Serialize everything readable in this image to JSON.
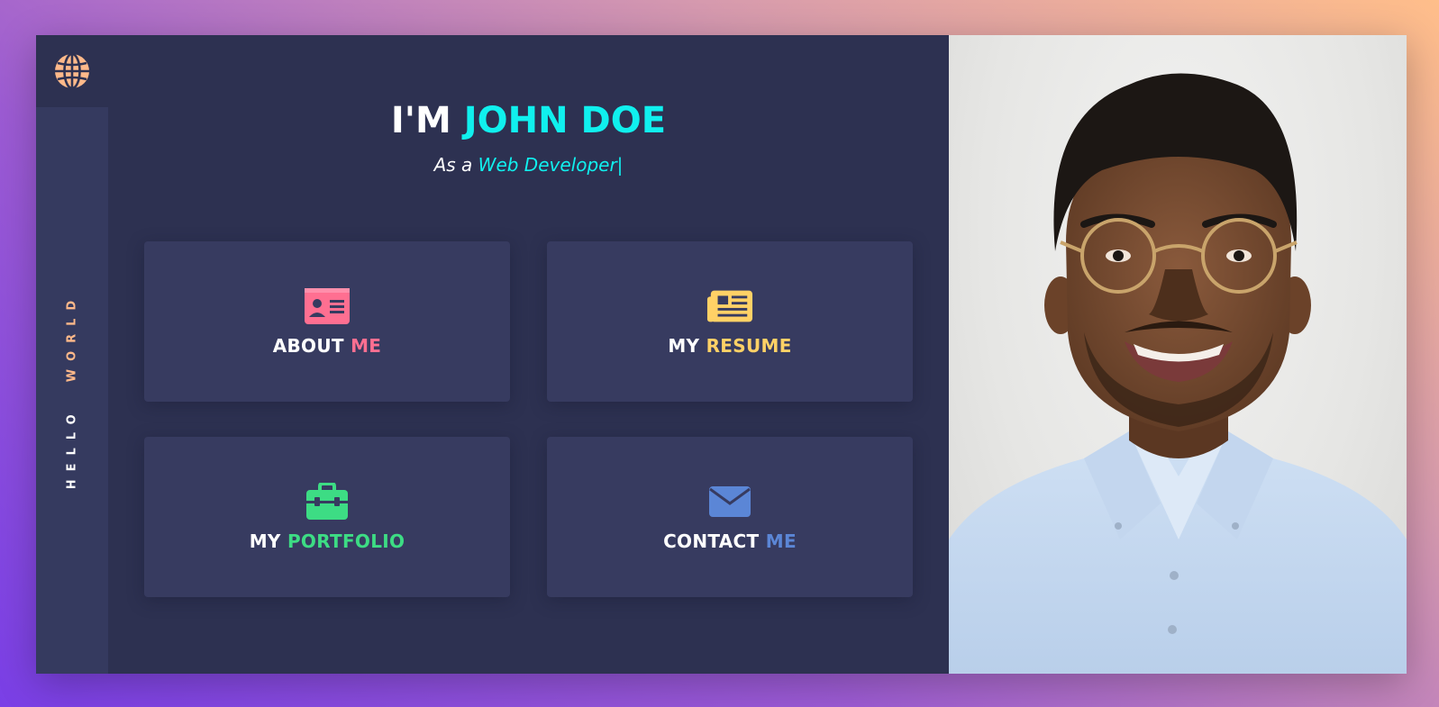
{
  "sidebar": {
    "logo_icon": "globe-icon",
    "vertical_word1": "HELLO",
    "vertical_word2": "WORLD"
  },
  "hero": {
    "title_prefix": "I'M",
    "title_name": "JOHN DOE",
    "subtitle_prefix": "As a",
    "subtitle_role": "Web Developer|"
  },
  "tiles": [
    {
      "word1": "ABOUT",
      "word2": "ME",
      "icon": "id-card-icon",
      "accent": "#ff6f91"
    },
    {
      "word1": "MY",
      "word2": "RESUME",
      "icon": "newspaper-icon",
      "accent": "#ffd166"
    },
    {
      "word1": "MY",
      "word2": "PORTFOLIO",
      "icon": "briefcase-icon",
      "accent": "#3ddc84"
    },
    {
      "word1": "CONTACT",
      "word2": "ME",
      "icon": "envelope-icon",
      "accent": "#5b86d6"
    }
  ],
  "colors": {
    "panel": "#2d3151",
    "sidebar": "#353a5f",
    "tile": "#373b60",
    "cyan": "#10f0ee",
    "orange": "#ffb98a"
  },
  "photo": {
    "subject": "portrait-photo"
  }
}
